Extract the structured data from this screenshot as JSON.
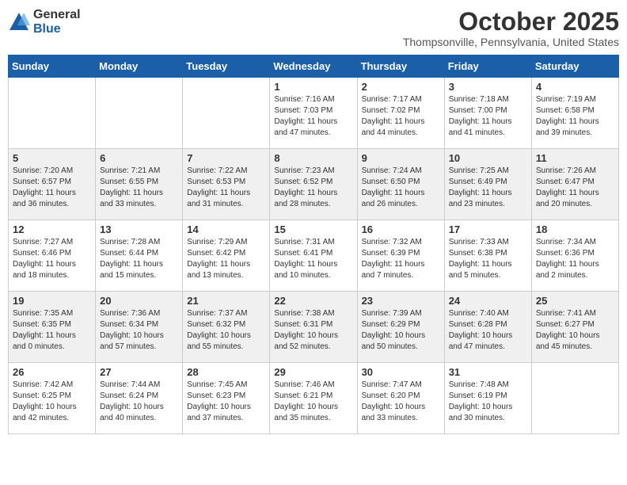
{
  "logo": {
    "general": "General",
    "blue": "Blue"
  },
  "header": {
    "month": "October 2025",
    "location": "Thompsonville, Pennsylvania, United States"
  },
  "weekdays": [
    "Sunday",
    "Monday",
    "Tuesday",
    "Wednesday",
    "Thursday",
    "Friday",
    "Saturday"
  ],
  "weeks": [
    [
      {
        "day": "",
        "info": ""
      },
      {
        "day": "",
        "info": ""
      },
      {
        "day": "",
        "info": ""
      },
      {
        "day": "1",
        "info": "Sunrise: 7:16 AM\nSunset: 7:03 PM\nDaylight: 11 hours and 47 minutes."
      },
      {
        "day": "2",
        "info": "Sunrise: 7:17 AM\nSunset: 7:02 PM\nDaylight: 11 hours and 44 minutes."
      },
      {
        "day": "3",
        "info": "Sunrise: 7:18 AM\nSunset: 7:00 PM\nDaylight: 11 hours and 41 minutes."
      },
      {
        "day": "4",
        "info": "Sunrise: 7:19 AM\nSunset: 6:58 PM\nDaylight: 11 hours and 39 minutes."
      }
    ],
    [
      {
        "day": "5",
        "info": "Sunrise: 7:20 AM\nSunset: 6:57 PM\nDaylight: 11 hours and 36 minutes."
      },
      {
        "day": "6",
        "info": "Sunrise: 7:21 AM\nSunset: 6:55 PM\nDaylight: 11 hours and 33 minutes."
      },
      {
        "day": "7",
        "info": "Sunrise: 7:22 AM\nSunset: 6:53 PM\nDaylight: 11 hours and 31 minutes."
      },
      {
        "day": "8",
        "info": "Sunrise: 7:23 AM\nSunset: 6:52 PM\nDaylight: 11 hours and 28 minutes."
      },
      {
        "day": "9",
        "info": "Sunrise: 7:24 AM\nSunset: 6:50 PM\nDaylight: 11 hours and 26 minutes."
      },
      {
        "day": "10",
        "info": "Sunrise: 7:25 AM\nSunset: 6:49 PM\nDaylight: 11 hours and 23 minutes."
      },
      {
        "day": "11",
        "info": "Sunrise: 7:26 AM\nSunset: 6:47 PM\nDaylight: 11 hours and 20 minutes."
      }
    ],
    [
      {
        "day": "12",
        "info": "Sunrise: 7:27 AM\nSunset: 6:46 PM\nDaylight: 11 hours and 18 minutes."
      },
      {
        "day": "13",
        "info": "Sunrise: 7:28 AM\nSunset: 6:44 PM\nDaylight: 11 hours and 15 minutes."
      },
      {
        "day": "14",
        "info": "Sunrise: 7:29 AM\nSunset: 6:42 PM\nDaylight: 11 hours and 13 minutes."
      },
      {
        "day": "15",
        "info": "Sunrise: 7:31 AM\nSunset: 6:41 PM\nDaylight: 11 hours and 10 minutes."
      },
      {
        "day": "16",
        "info": "Sunrise: 7:32 AM\nSunset: 6:39 PM\nDaylight: 11 hours and 7 minutes."
      },
      {
        "day": "17",
        "info": "Sunrise: 7:33 AM\nSunset: 6:38 PM\nDaylight: 11 hours and 5 minutes."
      },
      {
        "day": "18",
        "info": "Sunrise: 7:34 AM\nSunset: 6:36 PM\nDaylight: 11 hours and 2 minutes."
      }
    ],
    [
      {
        "day": "19",
        "info": "Sunrise: 7:35 AM\nSunset: 6:35 PM\nDaylight: 11 hours and 0 minutes."
      },
      {
        "day": "20",
        "info": "Sunrise: 7:36 AM\nSunset: 6:34 PM\nDaylight: 10 hours and 57 minutes."
      },
      {
        "day": "21",
        "info": "Sunrise: 7:37 AM\nSunset: 6:32 PM\nDaylight: 10 hours and 55 minutes."
      },
      {
        "day": "22",
        "info": "Sunrise: 7:38 AM\nSunset: 6:31 PM\nDaylight: 10 hours and 52 minutes."
      },
      {
        "day": "23",
        "info": "Sunrise: 7:39 AM\nSunset: 6:29 PM\nDaylight: 10 hours and 50 minutes."
      },
      {
        "day": "24",
        "info": "Sunrise: 7:40 AM\nSunset: 6:28 PM\nDaylight: 10 hours and 47 minutes."
      },
      {
        "day": "25",
        "info": "Sunrise: 7:41 AM\nSunset: 6:27 PM\nDaylight: 10 hours and 45 minutes."
      }
    ],
    [
      {
        "day": "26",
        "info": "Sunrise: 7:42 AM\nSunset: 6:25 PM\nDaylight: 10 hours and 42 minutes."
      },
      {
        "day": "27",
        "info": "Sunrise: 7:44 AM\nSunset: 6:24 PM\nDaylight: 10 hours and 40 minutes."
      },
      {
        "day": "28",
        "info": "Sunrise: 7:45 AM\nSunset: 6:23 PM\nDaylight: 10 hours and 37 minutes."
      },
      {
        "day": "29",
        "info": "Sunrise: 7:46 AM\nSunset: 6:21 PM\nDaylight: 10 hours and 35 minutes."
      },
      {
        "day": "30",
        "info": "Sunrise: 7:47 AM\nSunset: 6:20 PM\nDaylight: 10 hours and 33 minutes."
      },
      {
        "day": "31",
        "info": "Sunrise: 7:48 AM\nSunset: 6:19 PM\nDaylight: 10 hours and 30 minutes."
      },
      {
        "day": "",
        "info": ""
      }
    ]
  ]
}
